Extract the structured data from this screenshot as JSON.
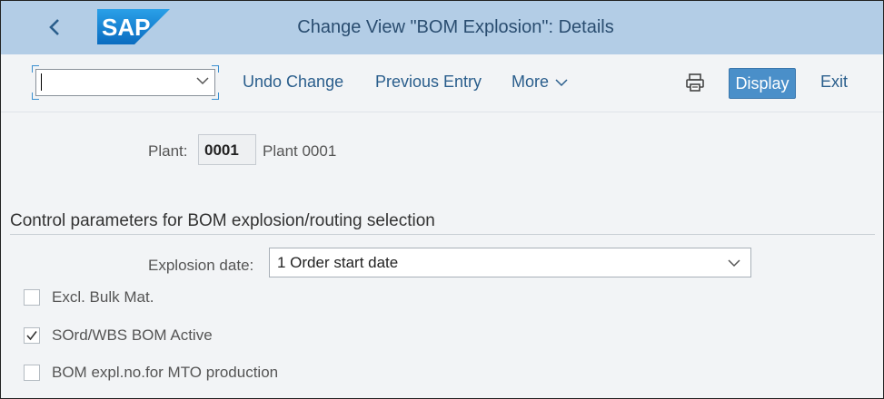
{
  "header": {
    "title": "Change View \"BOM Explosion\": Details",
    "logo_text": "SAP",
    "back_icon": "chevron-left-icon"
  },
  "toolbar": {
    "command_value": "",
    "undo_label": "Undo Change",
    "previous_label": "Previous Entry",
    "more_label": "More",
    "print_icon": "printer-icon",
    "display_label": "Display",
    "exit_label": "Exit"
  },
  "plant": {
    "label": "Plant:",
    "value": "0001",
    "description": "Plant 0001"
  },
  "section": {
    "title": "Control parameters for BOM explosion/routing selection"
  },
  "explosion_date": {
    "label": "Explosion date:",
    "value": "1 Order start date"
  },
  "checkboxes": [
    {
      "label": "Excl. Bulk Mat.",
      "checked": false
    },
    {
      "label": "SOrd/WBS BOM Active",
      "checked": true
    },
    {
      "label": "BOM expl.no.for MTO production",
      "checked": false
    }
  ],
  "colors": {
    "shell_bg": "#b3cde6",
    "accent": "#4a8fc9",
    "link": "#2a5e8c",
    "logo": "#1a7fcf"
  }
}
